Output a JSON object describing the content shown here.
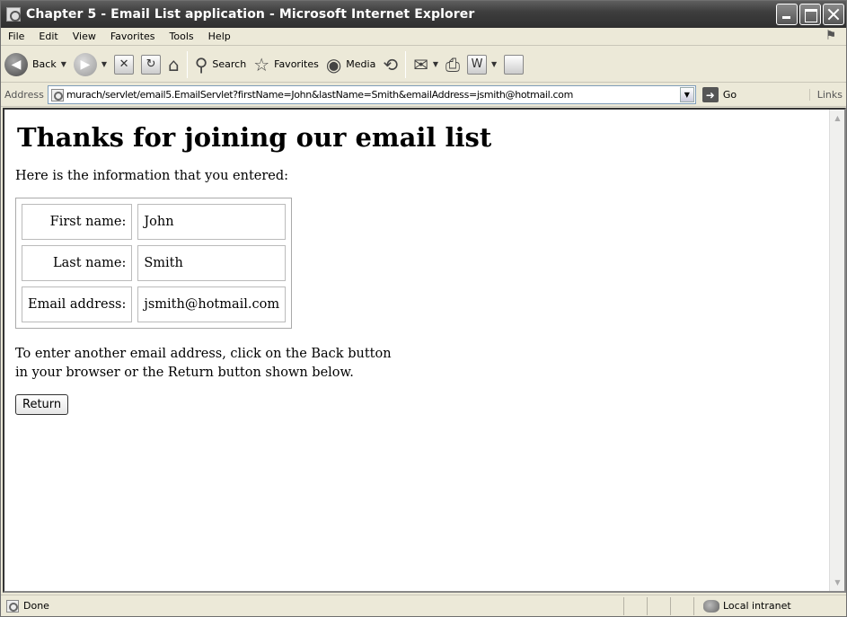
{
  "window": {
    "title": "Chapter 5 - Email List application - Microsoft Internet Explorer"
  },
  "menu": [
    "File",
    "Edit",
    "View",
    "Favorites",
    "Tools",
    "Help"
  ],
  "toolbar": {
    "back_label": "Back",
    "search_label": "Search",
    "favorites_label": "Favorites",
    "media_label": "Media"
  },
  "address": {
    "label": "Address",
    "url": "murach/servlet/email5.EmailServlet?firstName=John&lastName=Smith&emailAddress=jsmith@hotmail.com",
    "go_label": "Go",
    "links_label": "Links"
  },
  "page": {
    "heading": "Thanks for joining our email list",
    "intro": "Here is the information that you entered:",
    "rows": [
      {
        "label": "First name:",
        "value": "John"
      },
      {
        "label": "Last name:",
        "value": "Smith"
      },
      {
        "label": "Email address:",
        "value": "jsmith@hotmail.com"
      }
    ],
    "note": "To enter another email address, click on the Back button in your browser or the Return button shown below.",
    "return_label": "Return"
  },
  "status": {
    "text": "Done",
    "zone": "Local intranet"
  }
}
